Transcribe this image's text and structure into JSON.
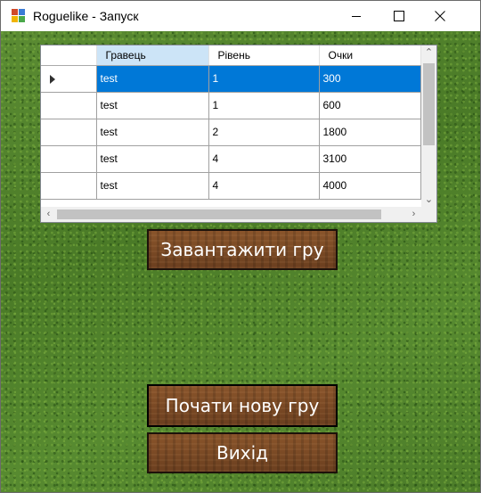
{
  "window": {
    "title": "Roguelike - Запуск"
  },
  "grid": {
    "columns": [
      "Гравець",
      "Рівень",
      "Очки"
    ],
    "rows": [
      [
        "test",
        "1",
        "300"
      ],
      [
        "test",
        "1",
        "600"
      ],
      [
        "test",
        "2",
        "1800"
      ],
      [
        "test",
        "4",
        "3100"
      ],
      [
        "test",
        "4",
        "4000"
      ]
    ],
    "selected_row": 0
  },
  "buttons": {
    "load": "Завантажити гру",
    "new_game": "Почати нову гру",
    "exit": "Вихід"
  },
  "icons": {
    "app": "app-window-icon",
    "minimize": "minimize-icon",
    "maximize": "maximize-icon",
    "close": "close-icon",
    "row_pointer": "row-pointer-icon"
  },
  "colors": {
    "selection": "#0078d7",
    "header_selected": "#cce4f7",
    "wood": "#7a4a25",
    "grass": "#4f7f2b"
  }
}
